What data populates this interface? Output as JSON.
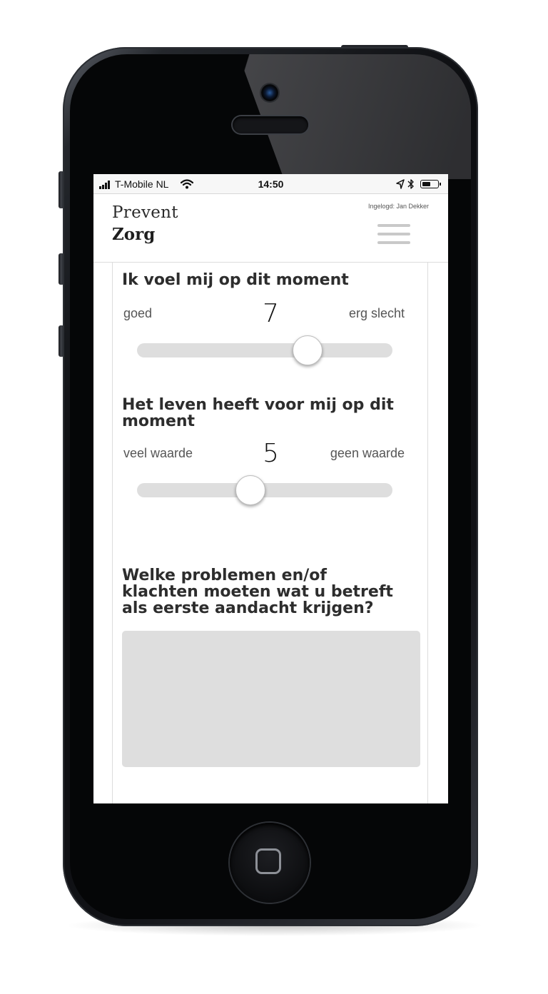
{
  "status_bar": {
    "carrier": "T-Mobile NL",
    "time": "14:50",
    "battery_level": 0.55
  },
  "header": {
    "logo_line1": "Prevent",
    "logo_line2": "Zorg",
    "user_info": "Ingelogd: Jan Dekker",
    "menu_icon": "hamburger-menu-icon"
  },
  "questions": [
    {
      "title": "Ik voel mij op dit moment",
      "left_label": "goed",
      "right_label": "erg slecht",
      "value": "7",
      "min": 1,
      "max": 10,
      "fraction": 0.667
    },
    {
      "title": "Het leven heeft voor mij op dit moment",
      "left_label": "veel waarde",
      "right_label": "geen waarde",
      "value": "5",
      "min": 1,
      "max": 10,
      "fraction": 0.444
    },
    {
      "title": "Welke problemen en/of klachten moeten wat u betreft als eerste aandacht krijgen?",
      "answer": ""
    }
  ],
  "colors": {
    "track": "#dedede",
    "heading": "#2d2d2d",
    "label": "#555555",
    "menu_lines": "#c9c9c9"
  }
}
